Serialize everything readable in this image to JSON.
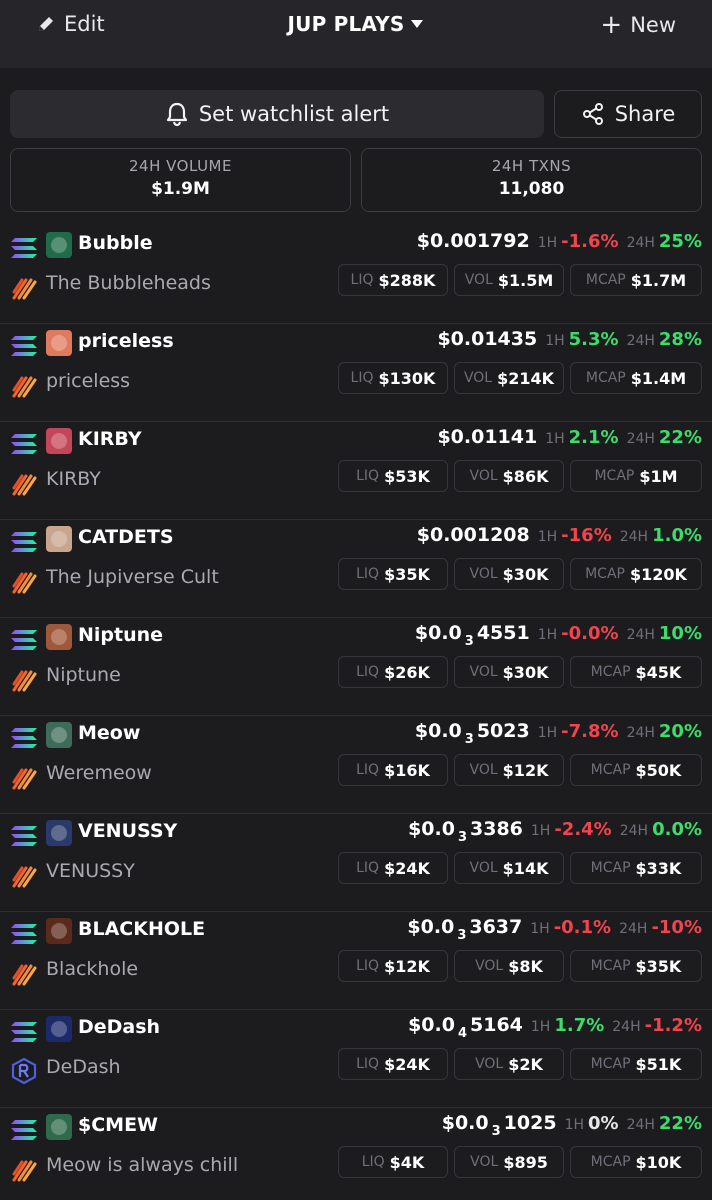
{
  "header": {
    "edit_label": "Edit",
    "title": "JUP PLAYS",
    "new_label": "New"
  },
  "actions": {
    "alert_label": "Set watchlist alert",
    "share_label": "Share"
  },
  "stats": {
    "volume_label": "24H VOLUME",
    "volume_value": "$1.9M",
    "txns_label": "24H TXNS",
    "txns_value": "11,080"
  },
  "labels": {
    "h1": "1H",
    "h24": "24H",
    "liq": "LIQ",
    "vol": "VOL",
    "mcap": "MCAP"
  },
  "tokens": [
    {
      "symbol": "Bubble",
      "name": "The Bubbleheads",
      "price_main": "$0.001792",
      "price_sub": "",
      "price_tail": "",
      "h1": "-1.6%",
      "h24": "25%",
      "liq": "$288K",
      "vol": "$1.5M",
      "mcap": "$1.7M",
      "h1_dir": "neg",
      "h24_dir": "pos",
      "dex": "flame",
      "icon_color": "#1f6b4a"
    },
    {
      "symbol": "priceless",
      "name": "priceless",
      "price_main": "$0.01435",
      "price_sub": "",
      "price_tail": "",
      "h1": "5.3%",
      "h24": "28%",
      "liq": "$130K",
      "vol": "$214K",
      "mcap": "$1.4M",
      "h1_dir": "pos",
      "h24_dir": "pos",
      "dex": "flame",
      "icon_color": "#e07a5f"
    },
    {
      "symbol": "KIRBY",
      "name": "KIRBY",
      "price_main": "$0.01141",
      "price_sub": "",
      "price_tail": "",
      "h1": "2.1%",
      "h24": "22%",
      "liq": "$53K",
      "vol": "$86K",
      "mcap": "$1M",
      "h1_dir": "pos",
      "h24_dir": "pos",
      "dex": "flame",
      "icon_color": "#c4465a"
    },
    {
      "symbol": "CATDETS",
      "name": "The Jupiverse Cult",
      "price_main": "$0.001208",
      "price_sub": "",
      "price_tail": "",
      "h1": "-16%",
      "h24": "1.0%",
      "liq": "$35K",
      "vol": "$30K",
      "mcap": "$120K",
      "h1_dir": "neg",
      "h24_dir": "pos",
      "dex": "flame",
      "icon_color": "#c9a58e"
    },
    {
      "symbol": "Niptune",
      "name": "Niptune",
      "price_main": "$0.0",
      "price_sub": "3",
      "price_tail": "4551",
      "h1": "-0.0%",
      "h24": "10%",
      "liq": "$26K",
      "vol": "$30K",
      "mcap": "$45K",
      "h1_dir": "neg",
      "h24_dir": "pos",
      "dex": "flame",
      "icon_color": "#a0583a"
    },
    {
      "symbol": "Meow",
      "name": "Weremeow",
      "price_main": "$0.0",
      "price_sub": "3",
      "price_tail": "5023",
      "h1": "-7.8%",
      "h24": "20%",
      "liq": "$16K",
      "vol": "$12K",
      "mcap": "$50K",
      "h1_dir": "neg",
      "h24_dir": "pos",
      "dex": "flame",
      "icon_color": "#3f6b5a"
    },
    {
      "symbol": "VENUSSY",
      "name": "VENUSSY",
      "price_main": "$0.0",
      "price_sub": "3",
      "price_tail": "3386",
      "h1": "-2.4%",
      "h24": "0.0%",
      "liq": "$24K",
      "vol": "$14K",
      "mcap": "$33K",
      "h1_dir": "neg",
      "h24_dir": "pos",
      "dex": "flame",
      "icon_color": "#2a3a6a"
    },
    {
      "symbol": "BLACKHOLE",
      "name": "Blackhole",
      "price_main": "$0.0",
      "price_sub": "3",
      "price_tail": "3637",
      "h1": "-0.1%",
      "h24": "-10%",
      "liq": "$12K",
      "vol": "$8K",
      "mcap": "$35K",
      "h1_dir": "neg",
      "h24_dir": "neg",
      "dex": "flame",
      "icon_color": "#5a2a1c"
    },
    {
      "symbol": "DeDash",
      "name": "DeDash",
      "price_main": "$0.0",
      "price_sub": "4",
      "price_tail": "5164",
      "h1": "1.7%",
      "h24": "-1.2%",
      "liq": "$24K",
      "vol": "$2K",
      "mcap": "$51K",
      "h1_dir": "pos",
      "h24_dir": "neg",
      "dex": "raydium",
      "icon_color": "#1c2a6a"
    },
    {
      "symbol": "$CMEW",
      "name": "Meow is always chill",
      "price_main": "$0.0",
      "price_sub": "3",
      "price_tail": "1025",
      "h1": "0%",
      "h24": "22%",
      "liq": "$4K",
      "vol": "$895",
      "mcap": "$10K",
      "h1_dir": "neu",
      "h24_dir": "pos",
      "dex": "flame",
      "icon_color": "#2f6a4a"
    }
  ]
}
